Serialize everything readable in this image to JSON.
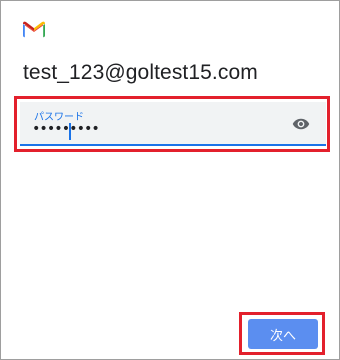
{
  "header": {
    "logo_icon": "gmail-icon",
    "account_email": "test_123@goltest15.com"
  },
  "password_field": {
    "label": "パスワード",
    "value": "•••••••••",
    "toggle_icon": "eye-icon",
    "focused": true
  },
  "actions": {
    "next_label": "次へ"
  },
  "colors": {
    "accent": "#1a73e8",
    "button": "#5b8ef0",
    "highlight": "#e3202c",
    "field_background": "#f1f3f4",
    "gmail_red": "#ea4335",
    "gmail_blue": "#4285f4",
    "gmail_green": "#34a853",
    "gmail_yellow": "#fbbc04"
  }
}
